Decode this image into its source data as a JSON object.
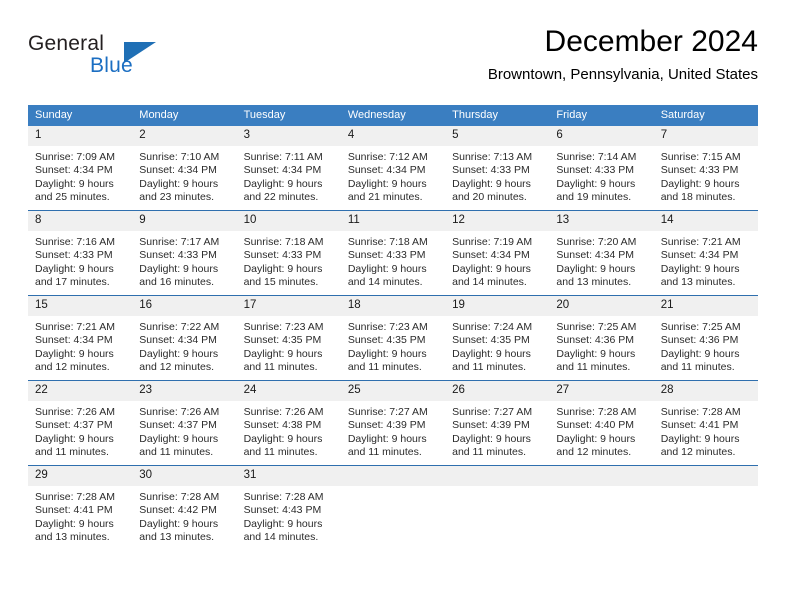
{
  "brand": {
    "name_part1": "General",
    "name_part2": "Blue",
    "logo_icon": "triangle-logo-icon"
  },
  "header": {
    "title": "December 2024",
    "location": "Browntown, Pennsylvania, United States"
  },
  "colors": {
    "header_blue": "#3a7ec1",
    "separator_blue": "#2f6fae",
    "daynum_band": "#f0f0f0",
    "brand_blue": "#1b6ec2"
  },
  "weekday_headers": [
    "Sunday",
    "Monday",
    "Tuesday",
    "Wednesday",
    "Thursday",
    "Friday",
    "Saturday"
  ],
  "weeks": [
    [
      {
        "day": "1",
        "sunrise": "Sunrise: 7:09 AM",
        "sunset": "Sunset: 4:34 PM",
        "daylight_line1": "Daylight: 9 hours",
        "daylight_line2": "and 25 minutes."
      },
      {
        "day": "2",
        "sunrise": "Sunrise: 7:10 AM",
        "sunset": "Sunset: 4:34 PM",
        "daylight_line1": "Daylight: 9 hours",
        "daylight_line2": "and 23 minutes."
      },
      {
        "day": "3",
        "sunrise": "Sunrise: 7:11 AM",
        "sunset": "Sunset: 4:34 PM",
        "daylight_line1": "Daylight: 9 hours",
        "daylight_line2": "and 22 minutes."
      },
      {
        "day": "4",
        "sunrise": "Sunrise: 7:12 AM",
        "sunset": "Sunset: 4:34 PM",
        "daylight_line1": "Daylight: 9 hours",
        "daylight_line2": "and 21 minutes."
      },
      {
        "day": "5",
        "sunrise": "Sunrise: 7:13 AM",
        "sunset": "Sunset: 4:33 PM",
        "daylight_line1": "Daylight: 9 hours",
        "daylight_line2": "and 20 minutes."
      },
      {
        "day": "6",
        "sunrise": "Sunrise: 7:14 AM",
        "sunset": "Sunset: 4:33 PM",
        "daylight_line1": "Daylight: 9 hours",
        "daylight_line2": "and 19 minutes."
      },
      {
        "day": "7",
        "sunrise": "Sunrise: 7:15 AM",
        "sunset": "Sunset: 4:33 PM",
        "daylight_line1": "Daylight: 9 hours",
        "daylight_line2": "and 18 minutes."
      }
    ],
    [
      {
        "day": "8",
        "sunrise": "Sunrise: 7:16 AM",
        "sunset": "Sunset: 4:33 PM",
        "daylight_line1": "Daylight: 9 hours",
        "daylight_line2": "and 17 minutes."
      },
      {
        "day": "9",
        "sunrise": "Sunrise: 7:17 AM",
        "sunset": "Sunset: 4:33 PM",
        "daylight_line1": "Daylight: 9 hours",
        "daylight_line2": "and 16 minutes."
      },
      {
        "day": "10",
        "sunrise": "Sunrise: 7:18 AM",
        "sunset": "Sunset: 4:33 PM",
        "daylight_line1": "Daylight: 9 hours",
        "daylight_line2": "and 15 minutes."
      },
      {
        "day": "11",
        "sunrise": "Sunrise: 7:18 AM",
        "sunset": "Sunset: 4:33 PM",
        "daylight_line1": "Daylight: 9 hours",
        "daylight_line2": "and 14 minutes."
      },
      {
        "day": "12",
        "sunrise": "Sunrise: 7:19 AM",
        "sunset": "Sunset: 4:34 PM",
        "daylight_line1": "Daylight: 9 hours",
        "daylight_line2": "and 14 minutes."
      },
      {
        "day": "13",
        "sunrise": "Sunrise: 7:20 AM",
        "sunset": "Sunset: 4:34 PM",
        "daylight_line1": "Daylight: 9 hours",
        "daylight_line2": "and 13 minutes."
      },
      {
        "day": "14",
        "sunrise": "Sunrise: 7:21 AM",
        "sunset": "Sunset: 4:34 PM",
        "daylight_line1": "Daylight: 9 hours",
        "daylight_line2": "and 13 minutes."
      }
    ],
    [
      {
        "day": "15",
        "sunrise": "Sunrise: 7:21 AM",
        "sunset": "Sunset: 4:34 PM",
        "daylight_line1": "Daylight: 9 hours",
        "daylight_line2": "and 12 minutes."
      },
      {
        "day": "16",
        "sunrise": "Sunrise: 7:22 AM",
        "sunset": "Sunset: 4:34 PM",
        "daylight_line1": "Daylight: 9 hours",
        "daylight_line2": "and 12 minutes."
      },
      {
        "day": "17",
        "sunrise": "Sunrise: 7:23 AM",
        "sunset": "Sunset: 4:35 PM",
        "daylight_line1": "Daylight: 9 hours",
        "daylight_line2": "and 11 minutes."
      },
      {
        "day": "18",
        "sunrise": "Sunrise: 7:23 AM",
        "sunset": "Sunset: 4:35 PM",
        "daylight_line1": "Daylight: 9 hours",
        "daylight_line2": "and 11 minutes."
      },
      {
        "day": "19",
        "sunrise": "Sunrise: 7:24 AM",
        "sunset": "Sunset: 4:35 PM",
        "daylight_line1": "Daylight: 9 hours",
        "daylight_line2": "and 11 minutes."
      },
      {
        "day": "20",
        "sunrise": "Sunrise: 7:25 AM",
        "sunset": "Sunset: 4:36 PM",
        "daylight_line1": "Daylight: 9 hours",
        "daylight_line2": "and 11 minutes."
      },
      {
        "day": "21",
        "sunrise": "Sunrise: 7:25 AM",
        "sunset": "Sunset: 4:36 PM",
        "daylight_line1": "Daylight: 9 hours",
        "daylight_line2": "and 11 minutes."
      }
    ],
    [
      {
        "day": "22",
        "sunrise": "Sunrise: 7:26 AM",
        "sunset": "Sunset: 4:37 PM",
        "daylight_line1": "Daylight: 9 hours",
        "daylight_line2": "and 11 minutes."
      },
      {
        "day": "23",
        "sunrise": "Sunrise: 7:26 AM",
        "sunset": "Sunset: 4:37 PM",
        "daylight_line1": "Daylight: 9 hours",
        "daylight_line2": "and 11 minutes."
      },
      {
        "day": "24",
        "sunrise": "Sunrise: 7:26 AM",
        "sunset": "Sunset: 4:38 PM",
        "daylight_line1": "Daylight: 9 hours",
        "daylight_line2": "and 11 minutes."
      },
      {
        "day": "25",
        "sunrise": "Sunrise: 7:27 AM",
        "sunset": "Sunset: 4:39 PM",
        "daylight_line1": "Daylight: 9 hours",
        "daylight_line2": "and 11 minutes."
      },
      {
        "day": "26",
        "sunrise": "Sunrise: 7:27 AM",
        "sunset": "Sunset: 4:39 PM",
        "daylight_line1": "Daylight: 9 hours",
        "daylight_line2": "and 11 minutes."
      },
      {
        "day": "27",
        "sunrise": "Sunrise: 7:28 AM",
        "sunset": "Sunset: 4:40 PM",
        "daylight_line1": "Daylight: 9 hours",
        "daylight_line2": "and 12 minutes."
      },
      {
        "day": "28",
        "sunrise": "Sunrise: 7:28 AM",
        "sunset": "Sunset: 4:41 PM",
        "daylight_line1": "Daylight: 9 hours",
        "daylight_line2": "and 12 minutes."
      }
    ],
    [
      {
        "day": "29",
        "sunrise": "Sunrise: 7:28 AM",
        "sunset": "Sunset: 4:41 PM",
        "daylight_line1": "Daylight: 9 hours",
        "daylight_line2": "and 13 minutes."
      },
      {
        "day": "30",
        "sunrise": "Sunrise: 7:28 AM",
        "sunset": "Sunset: 4:42 PM",
        "daylight_line1": "Daylight: 9 hours",
        "daylight_line2": "and 13 minutes."
      },
      {
        "day": "31",
        "sunrise": "Sunrise: 7:28 AM",
        "sunset": "Sunset: 4:43 PM",
        "daylight_line1": "Daylight: 9 hours",
        "daylight_line2": "and 14 minutes."
      },
      {
        "day": "",
        "sunrise": "",
        "sunset": "",
        "daylight_line1": "",
        "daylight_line2": ""
      },
      {
        "day": "",
        "sunrise": "",
        "sunset": "",
        "daylight_line1": "",
        "daylight_line2": ""
      },
      {
        "day": "",
        "sunrise": "",
        "sunset": "",
        "daylight_line1": "",
        "daylight_line2": ""
      },
      {
        "day": "",
        "sunrise": "",
        "sunset": "",
        "daylight_line1": "",
        "daylight_line2": ""
      }
    ]
  ]
}
